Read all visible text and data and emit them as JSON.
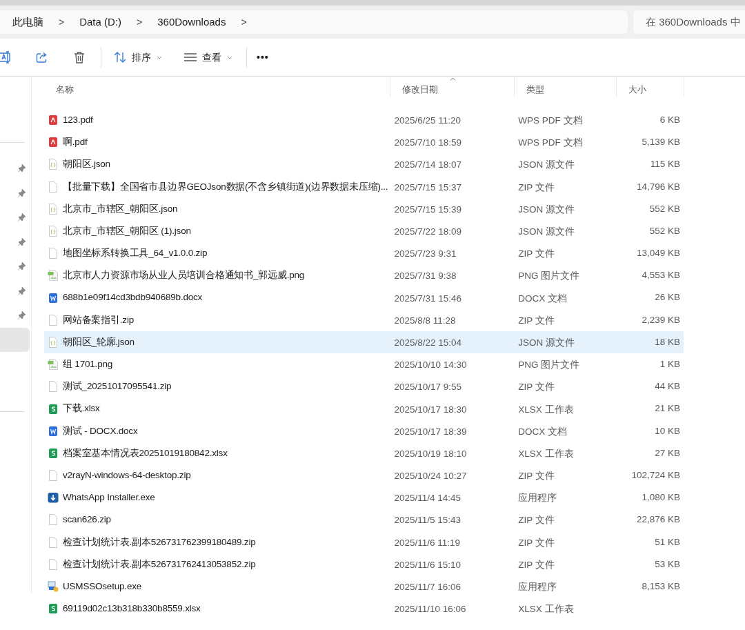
{
  "address_bar": {
    "breadcrumbs": [
      "此电脑",
      "Data (D:)",
      "360Downloads"
    ],
    "separator": ">"
  },
  "search": {
    "placeholder": "在 360Downloads 中"
  },
  "toolbar": {
    "sort_label": "排序",
    "view_label": "查看",
    "more": "•••"
  },
  "nav_items": [
    {
      "pinned": true,
      "selected": false
    },
    {
      "pinned": true,
      "selected": false
    },
    {
      "pinned": true,
      "selected": false
    },
    {
      "pinned": true,
      "selected": false
    },
    {
      "pinned": true,
      "selected": false
    },
    {
      "pinned": true,
      "selected": false
    },
    {
      "pinned": true,
      "selected": false
    },
    {
      "pinned": false,
      "selected": true
    }
  ],
  "table": {
    "columns": [
      {
        "label": "名称",
        "sorted": false
      },
      {
        "label": "修改日期",
        "sorted": true
      },
      {
        "label": "类型",
        "sorted": false
      },
      {
        "label": "大小",
        "sorted": false
      }
    ],
    "rows": [
      {
        "kind": "pdf",
        "name": "123.pdf",
        "modified": "2025/6/25 11:20",
        "type": "WPS PDF 文档",
        "size": "6 KB",
        "selected": false
      },
      {
        "kind": "pdf",
        "name": "啊.pdf",
        "modified": "2025/7/10 18:59",
        "type": "WPS PDF 文档",
        "size": "5,139 KB",
        "selected": false
      },
      {
        "kind": "json",
        "name": "朝阳区.json",
        "modified": "2025/7/14 18:07",
        "type": "JSON 源文件",
        "size": "115 KB",
        "selected": false
      },
      {
        "kind": "file",
        "name": "【批量下载】全国省市县边界GEOJson数据(不含乡镇街道)(边界数据未压缩)...",
        "modified": "2025/7/15 15:37",
        "type": "ZIP 文件",
        "size": "14,796 KB",
        "selected": false
      },
      {
        "kind": "json",
        "name": "北京市_市辖区_朝阳区.json",
        "modified": "2025/7/15 15:39",
        "type": "JSON 源文件",
        "size": "552 KB",
        "selected": false
      },
      {
        "kind": "json",
        "name": "北京市_市辖区_朝阳区 (1).json",
        "modified": "2025/7/22 18:09",
        "type": "JSON 源文件",
        "size": "552 KB",
        "selected": false
      },
      {
        "kind": "file",
        "name": "地图坐标系转换工具_64_v1.0.0.zip",
        "modified": "2025/7/23 9:31",
        "type": "ZIP 文件",
        "size": "13,049 KB",
        "selected": false
      },
      {
        "kind": "image",
        "name": "北京市人力资源市场从业人员培训合格通知书_郭远威.png",
        "modified": "2025/7/31 9:38",
        "type": "PNG 图片文件",
        "size": "4,553 KB",
        "selected": false
      },
      {
        "kind": "docx",
        "name": "688b1e09f14cd3bdb940689b.docx",
        "modified": "2025/7/31 15:46",
        "type": "DOCX 文档",
        "size": "26 KB",
        "selected": false
      },
      {
        "kind": "file",
        "name": "网站备案指引.zip",
        "modified": "2025/8/8 11:28",
        "type": "ZIP 文件",
        "size": "2,239 KB",
        "selected": false
      },
      {
        "kind": "json",
        "name": "朝阳区_轮廓.json",
        "modified": "2025/8/22 15:04",
        "type": "JSON 源文件",
        "size": "18 KB",
        "selected": true
      },
      {
        "kind": "image",
        "name": "组 1701.png",
        "modified": "2025/10/10 14:30",
        "type": "PNG 图片文件",
        "size": "1 KB",
        "selected": false
      },
      {
        "kind": "file",
        "name": "测试_20251017095541.zip",
        "modified": "2025/10/17 9:55",
        "type": "ZIP 文件",
        "size": "44 KB",
        "selected": false
      },
      {
        "kind": "xlsx",
        "name": "下载.xlsx",
        "modified": "2025/10/17 18:30",
        "type": "XLSX 工作表",
        "size": "21 KB",
        "selected": false
      },
      {
        "kind": "docx",
        "name": "测试 - DOCX.docx",
        "modified": "2025/10/17 18:39",
        "type": "DOCX 文档",
        "size": "10 KB",
        "selected": false
      },
      {
        "kind": "xlsx",
        "name": "档案室基本情况表20251019180842.xlsx",
        "modified": "2025/10/19 18:10",
        "type": "XLSX 工作表",
        "size": "27 KB",
        "selected": false
      },
      {
        "kind": "file",
        "name": "v2rayN-windows-64-desktop.zip",
        "modified": "2025/10/24 10:27",
        "type": "ZIP 文件",
        "size": "102,724 KB",
        "selected": false
      },
      {
        "kind": "installer",
        "name": "WhatsApp Installer.exe",
        "modified": "2025/11/4 14:45",
        "type": "应用程序",
        "size": "1,080 KB",
        "selected": false
      },
      {
        "kind": "file",
        "name": "scan626.zip",
        "modified": "2025/11/5 15:43",
        "type": "ZIP 文件",
        "size": "22,876 KB",
        "selected": false
      },
      {
        "kind": "file",
        "name": "检查计划统计表.副本526731762399180489.zip",
        "modified": "2025/11/6 11:19",
        "type": "ZIP 文件",
        "size": "51 KB",
        "selected": false
      },
      {
        "kind": "file",
        "name": "检查计划统计表.副本526731762413053852.zip",
        "modified": "2025/11/6 15:10",
        "type": "ZIP 文件",
        "size": "53 KB",
        "selected": false
      },
      {
        "kind": "setup",
        "name": "USMSSOsetup.exe",
        "modified": "2025/11/7 16:06",
        "type": "应用程序",
        "size": "8,153 KB",
        "selected": false
      },
      {
        "kind": "xlsx",
        "name": "69119d02c13b318b330b8559.xlsx",
        "modified": "2025/11/10 16:06",
        "type": "XLSX 工作表",
        "selected": false
      }
    ]
  }
}
